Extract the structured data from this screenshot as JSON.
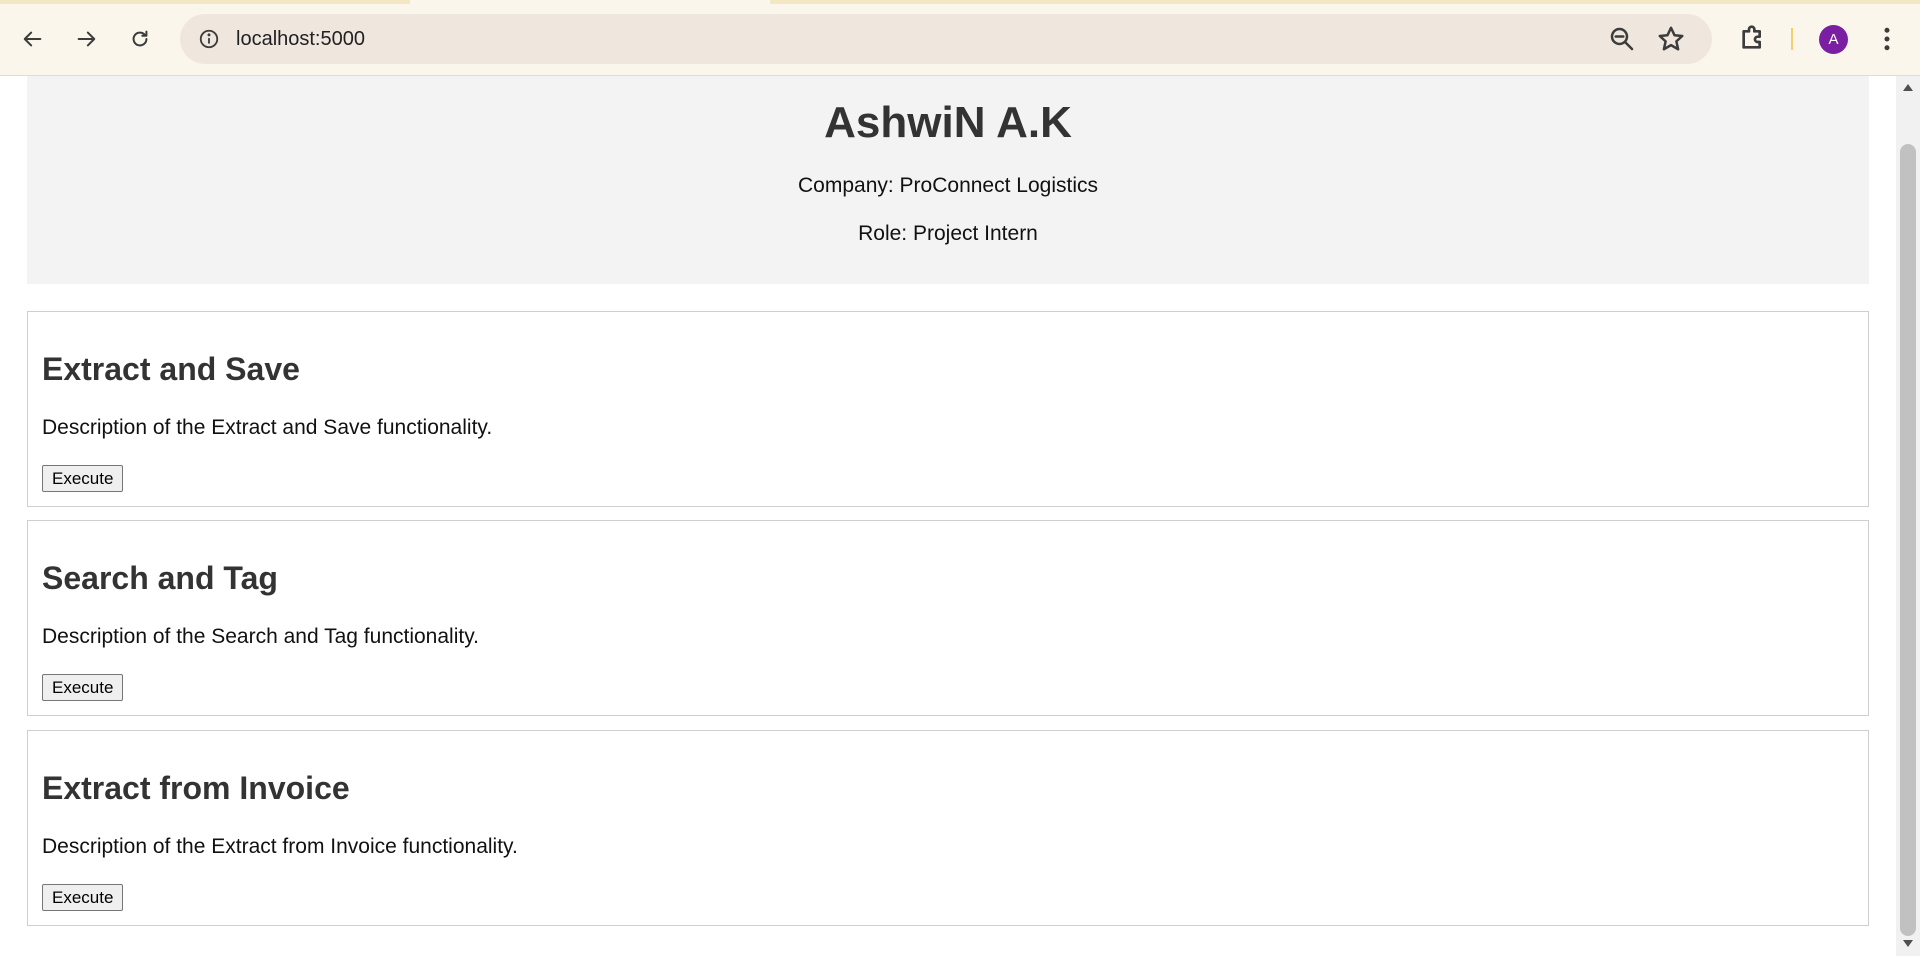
{
  "browser": {
    "url": "localhost:5000",
    "avatar_initial": "A",
    "icons": {
      "back": "arrow-left-icon",
      "forward": "arrow-right-icon",
      "reload": "reload-icon",
      "site_info": "info-icon",
      "zoom": "zoom-out-icon",
      "bookmark": "star-icon",
      "extensions": "puzzle-icon",
      "menu": "kebab-menu-icon"
    },
    "colors": {
      "chrome_background": "#fbf6ec",
      "omnibox_background": "#efe7dd",
      "avatar_background": "#7b1fa2"
    }
  },
  "profile": {
    "name": "AshwiN A.K",
    "company": "Company: ProConnect Logistics",
    "role": "Role: Project Intern"
  },
  "cards": [
    {
      "title": "Extract and Save",
      "description": "Description of the Extract and Save functionality.",
      "button_label": "Execute"
    },
    {
      "title": "Search and Tag",
      "description": "Description of the Search and Tag functionality.",
      "button_label": "Execute"
    },
    {
      "title": "Extract from Invoice",
      "description": "Description of the Extract from Invoice functionality.",
      "button_label": "Execute"
    }
  ]
}
